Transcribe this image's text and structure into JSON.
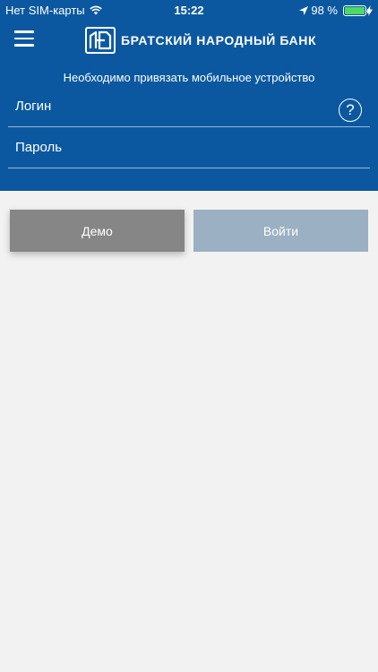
{
  "status_bar": {
    "carrier": "Нет SIM-карты",
    "time": "15:22",
    "battery_percent": "98 %",
    "battery_level": 0.98
  },
  "header": {
    "logo_abbr": "БНБ",
    "bank_name": "БРАТСКИЙ НАРОДНЫЙ БАНК",
    "notice": "Необходимо привязать мобильное устройство"
  },
  "form": {
    "login_placeholder": "Логин",
    "password_placeholder": "Пароль",
    "help_label": "?"
  },
  "actions": {
    "demo_label": "Демо",
    "login_label": "Войти"
  },
  "colors": {
    "header": "#0b58a0",
    "demo": "#868686",
    "login_disabled": "#9bb0c2",
    "background": "#f2f2f2"
  }
}
